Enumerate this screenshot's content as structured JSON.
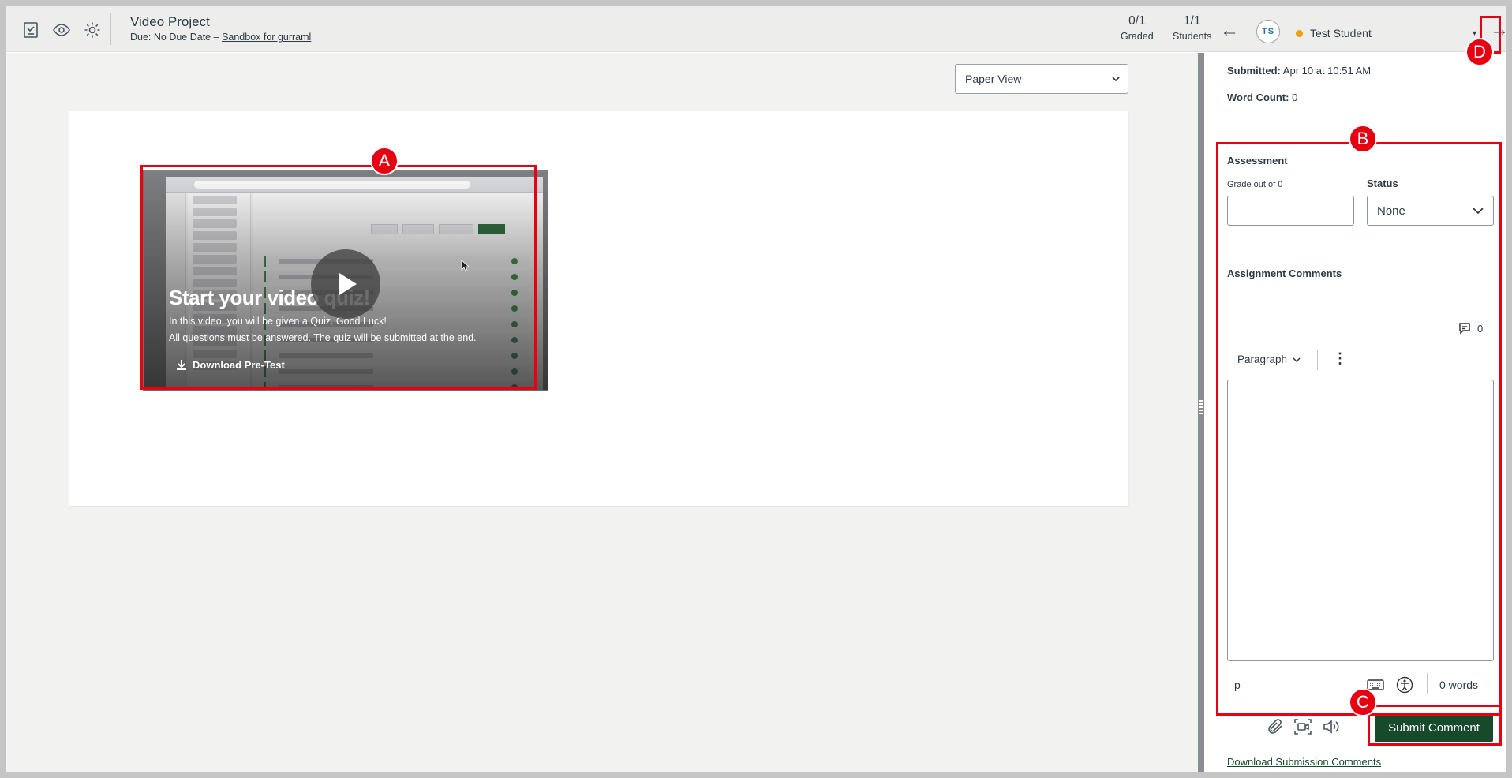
{
  "topbar": {
    "assignment_title": "Video Project",
    "due_text": "Due: No Due Date",
    "due_separator": "–",
    "course_link": "Sandbox for gurraml",
    "graded": {
      "value": "0/1",
      "label": "Graded"
    },
    "students": {
      "value": "1/1",
      "label": "Students"
    },
    "student_initials": "TS",
    "student_name": "Test Student",
    "student_status_color": "#f0a10a",
    "icons": [
      "gradebook-icon",
      "eye-icon",
      "gear-icon"
    ],
    "prev_symbol": "←",
    "next_symbol": "→",
    "caret_symbol": "▾"
  },
  "main": {
    "view_select": "Paper View",
    "video": {
      "title": "Start your video quiz!",
      "line1": "In this video, you will be given a Quiz. Good Luck!",
      "line2": "All questions must be answered. The quiz will be submitted at the end.",
      "download_label": "Download Pre-Test"
    }
  },
  "sidebar": {
    "submitted_label": "Submitted:",
    "submitted_value": "Apr 10 at 10:51 AM",
    "word_count_label": "Word Count:",
    "word_count_value": "0",
    "assessment_heading": "Assessment",
    "grade_label": "Grade out of 0",
    "grade_value": "",
    "status_label": "Status",
    "status_value": "None",
    "comments_heading": "Assignment Comments",
    "comment_count": "0",
    "paragraph_menu": "Paragraph",
    "more_symbol": "⋮",
    "editor_path": "p",
    "editor_word_count": "0 words",
    "submit_label": "Submit Comment",
    "download_comments": "Download Submission Comments"
  },
  "annotations": {
    "color": "#e60012",
    "labels": [
      "A",
      "B",
      "C",
      "D"
    ]
  },
  "colors": {
    "brand_green": "#164a2b",
    "topbar_bg": "#ededeb",
    "canvas_bg": "#f2f3f1"
  }
}
